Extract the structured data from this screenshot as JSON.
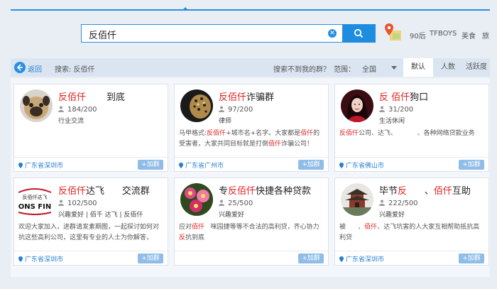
{
  "search": {
    "query": "反佰仟"
  },
  "hot_tags": [
    "90后",
    "TFBOYS",
    "美食",
    "旅"
  ],
  "nav": {
    "back": "返回",
    "search_label": "搜索: 反佰仟",
    "not_found": "搜索不到我的群？",
    "range_label": "范围：",
    "range_value": "全国",
    "sort_tabs": [
      "默认",
      "人数",
      "活跃度"
    ]
  },
  "accent_color": "#2a8fe0",
  "highlight_color": "#e02020",
  "cards": [
    {
      "name_parts": [
        {
          "t": "反佰仟",
          "h": true
        },
        {
          "t": "       到底",
          "h": false
        }
      ],
      "members": "184/200",
      "category": "行业交流",
      "desc": [],
      "location": "广东省深圳市",
      "join": "+加群",
      "avatar": "pug-dog-avatar"
    },
    {
      "name_parts": [
        {
          "t": "反佰仟",
          "h": true
        },
        {
          "t": "诈骗群",
          "h": false
        }
      ],
      "members": "97/200",
      "category": "律师",
      "desc": [
        {
          "t": "马甲格式:",
          "h": false
        },
        {
          "t": "反佰仟",
          "h": true
        },
        {
          "t": "+城市名+名字。大家都是",
          "h": false
        },
        {
          "t": "佰仟",
          "h": true
        },
        {
          "t": "的受害者，大家共同目标就是打倒",
          "h": false
        },
        {
          "t": "佰仟",
          "h": true
        },
        {
          "t": "诈骗公司！",
          "h": false
        }
      ],
      "location": "广东省广州市",
      "join": "+加群",
      "avatar": "leopard-avatar"
    },
    {
      "name_parts": [
        {
          "t": "反 ",
          "h": true
        },
        {
          "t": "佰仟",
          "h": true
        },
        {
          "t": "狗口",
          "h": false
        }
      ],
      "members": "31/200",
      "category": "生活休闲",
      "desc": [
        {
          "t": "反佰仟",
          "h": true
        },
        {
          "t": "公司、达飞、          、各种网络贷款业务",
          "h": false
        }
      ],
      "location": "广东省佛山市",
      "join": "+加群",
      "avatar": "woman-avatar"
    },
    {
      "name_parts": [
        {
          "t": "反佰仟",
          "h": true
        },
        {
          "t": "达飞      交流群",
          "h": false
        }
      ],
      "members": "102/500",
      "category": "兴趣爱好 | 佰千 达飞 | 反佰仟",
      "desc": [
        {
          "t": "欢迎大家加入，进群请发素期图，一起探讨如何对抗这些高利公司，这里有专业的人士为你解答，",
          "h": false
        }
      ],
      "location": "广东省深圳市",
      "join": "+加群",
      "avatar": "logo-avatar",
      "avatar_text": [
        "反佰仟达飞",
        "ONS FIN"
      ]
    },
    {
      "name_parts": [
        {
          "t": "专",
          "h": false
        },
        {
          "t": "反佰仟",
          "h": true
        },
        {
          "t": "快捷各种贷款",
          "h": false
        }
      ],
      "members": "25/500",
      "category": "兴趣爱好",
      "desc": [
        {
          "t": "应对",
          "h": false
        },
        {
          "t": "佰仟",
          "h": true
        },
        {
          "t": "   咪园捷等等不合法的高利贷，齐心协力",
          "h": false
        },
        {
          "t": "反",
          "h": true
        },
        {
          "t": "抗到底",
          "h": false
        }
      ],
      "location": "",
      "join": "+加群",
      "avatar": "flower-avatar"
    },
    {
      "name_parts": [
        {
          "t": "毕节",
          "h": false
        },
        {
          "t": "反",
          "h": true
        },
        {
          "t": "      、",
          "h": false
        },
        {
          "t": "佰仟",
          "h": true
        },
        {
          "t": "互助",
          "h": false
        }
      ],
      "members": "222/500",
      "category": "兴趣爱好",
      "desc": [
        {
          "t": "被      、",
          "h": false
        },
        {
          "t": "佰仟",
          "h": true
        },
        {
          "t": "、达飞坑害的人大家互相帮助抵抗高利贷",
          "h": false
        }
      ],
      "location": "广东省深圳市",
      "join": "+加群",
      "avatar": "pagoda-avatar"
    }
  ]
}
